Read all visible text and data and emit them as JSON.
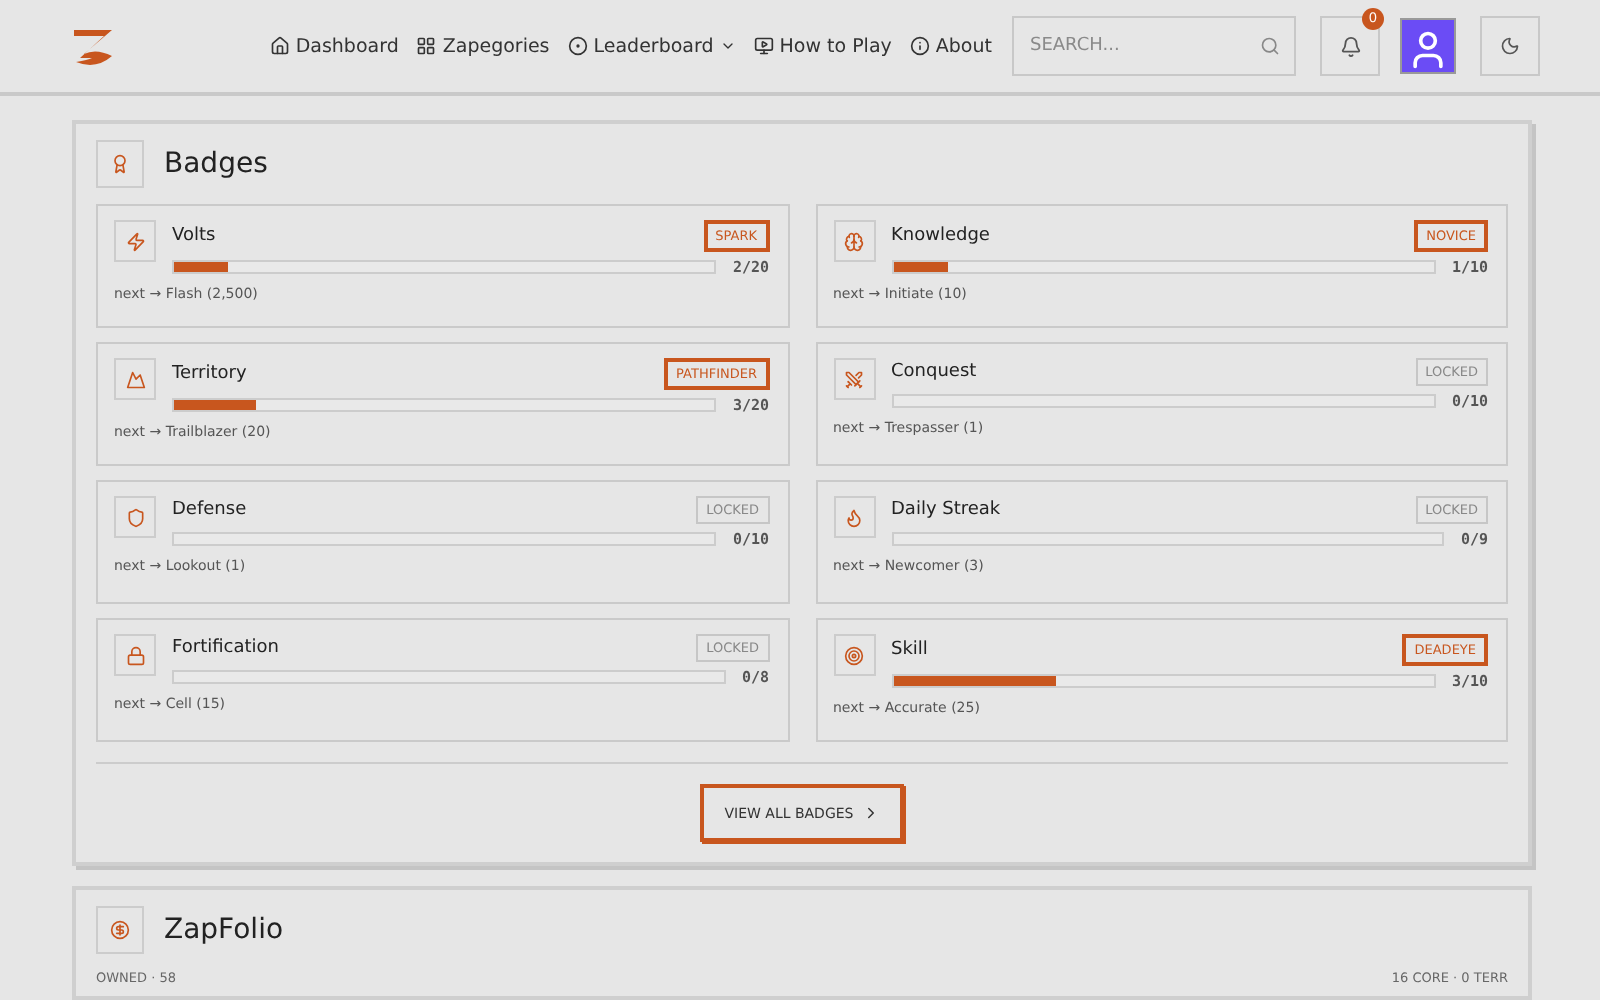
{
  "nav": {
    "items": [
      {
        "label": "Dashboard",
        "kind": "home"
      },
      {
        "label": "Zapegories",
        "kind": "grid"
      },
      {
        "label": "Leaderboard",
        "kind": "dropdown"
      },
      {
        "label": "How to Play",
        "kind": "play"
      },
      {
        "label": "About",
        "kind": "info"
      }
    ],
    "search": {
      "placeholder": "SEARCH..."
    },
    "notifications": {
      "count": "0"
    }
  },
  "badges": {
    "title": "Badges",
    "items": [
      {
        "name": "Volts",
        "tag": "SPARK",
        "locked": false,
        "level": 0.1,
        "reading": "2/20",
        "next": "next → Flash (2,500)",
        "kind": "bolt"
      },
      {
        "name": "Knowledge",
        "tag": "NOVICE",
        "locked": false,
        "level": 0.1,
        "reading": "1/10",
        "next": "next → Initiate (10)",
        "kind": "brain"
      },
      {
        "name": "Territory",
        "tag": "PATHFINDER",
        "locked": false,
        "level": 0.15,
        "reading": "3/20",
        "next": "next → Trailblazer (20)",
        "kind": "mountain"
      },
      {
        "name": "Conquest",
        "tag": "LOCKED",
        "locked": true,
        "level": 0,
        "reading": "0/10",
        "next": "next → Trespasser (1)",
        "kind": "swords"
      },
      {
        "name": "Defense",
        "tag": "LOCKED",
        "locked": true,
        "level": 0,
        "reading": "0/10",
        "next": "next → Lookout (1)",
        "kind": "shield"
      },
      {
        "name": "Daily Streak",
        "tag": "LOCKED",
        "locked": true,
        "level": 0,
        "reading": "0/9",
        "next": "next → Newcomer (3)",
        "kind": "flame"
      },
      {
        "name": "Fortification",
        "tag": "LOCKED",
        "locked": true,
        "level": 0,
        "reading": "0/8",
        "next": "next → Cell (15)",
        "kind": "lock"
      },
      {
        "name": "Skill",
        "tag": "DEADEYE",
        "locked": false,
        "level": 0.3,
        "reading": "3/10",
        "next": "next → Accurate (25)",
        "kind": "target"
      }
    ],
    "button": "VIEW ALL BADGES"
  },
  "zapfolio": {
    "title": "ZapFolio",
    "owned": "OWNED · 58",
    "summary": "16 CORE · 0 TERR"
  }
}
